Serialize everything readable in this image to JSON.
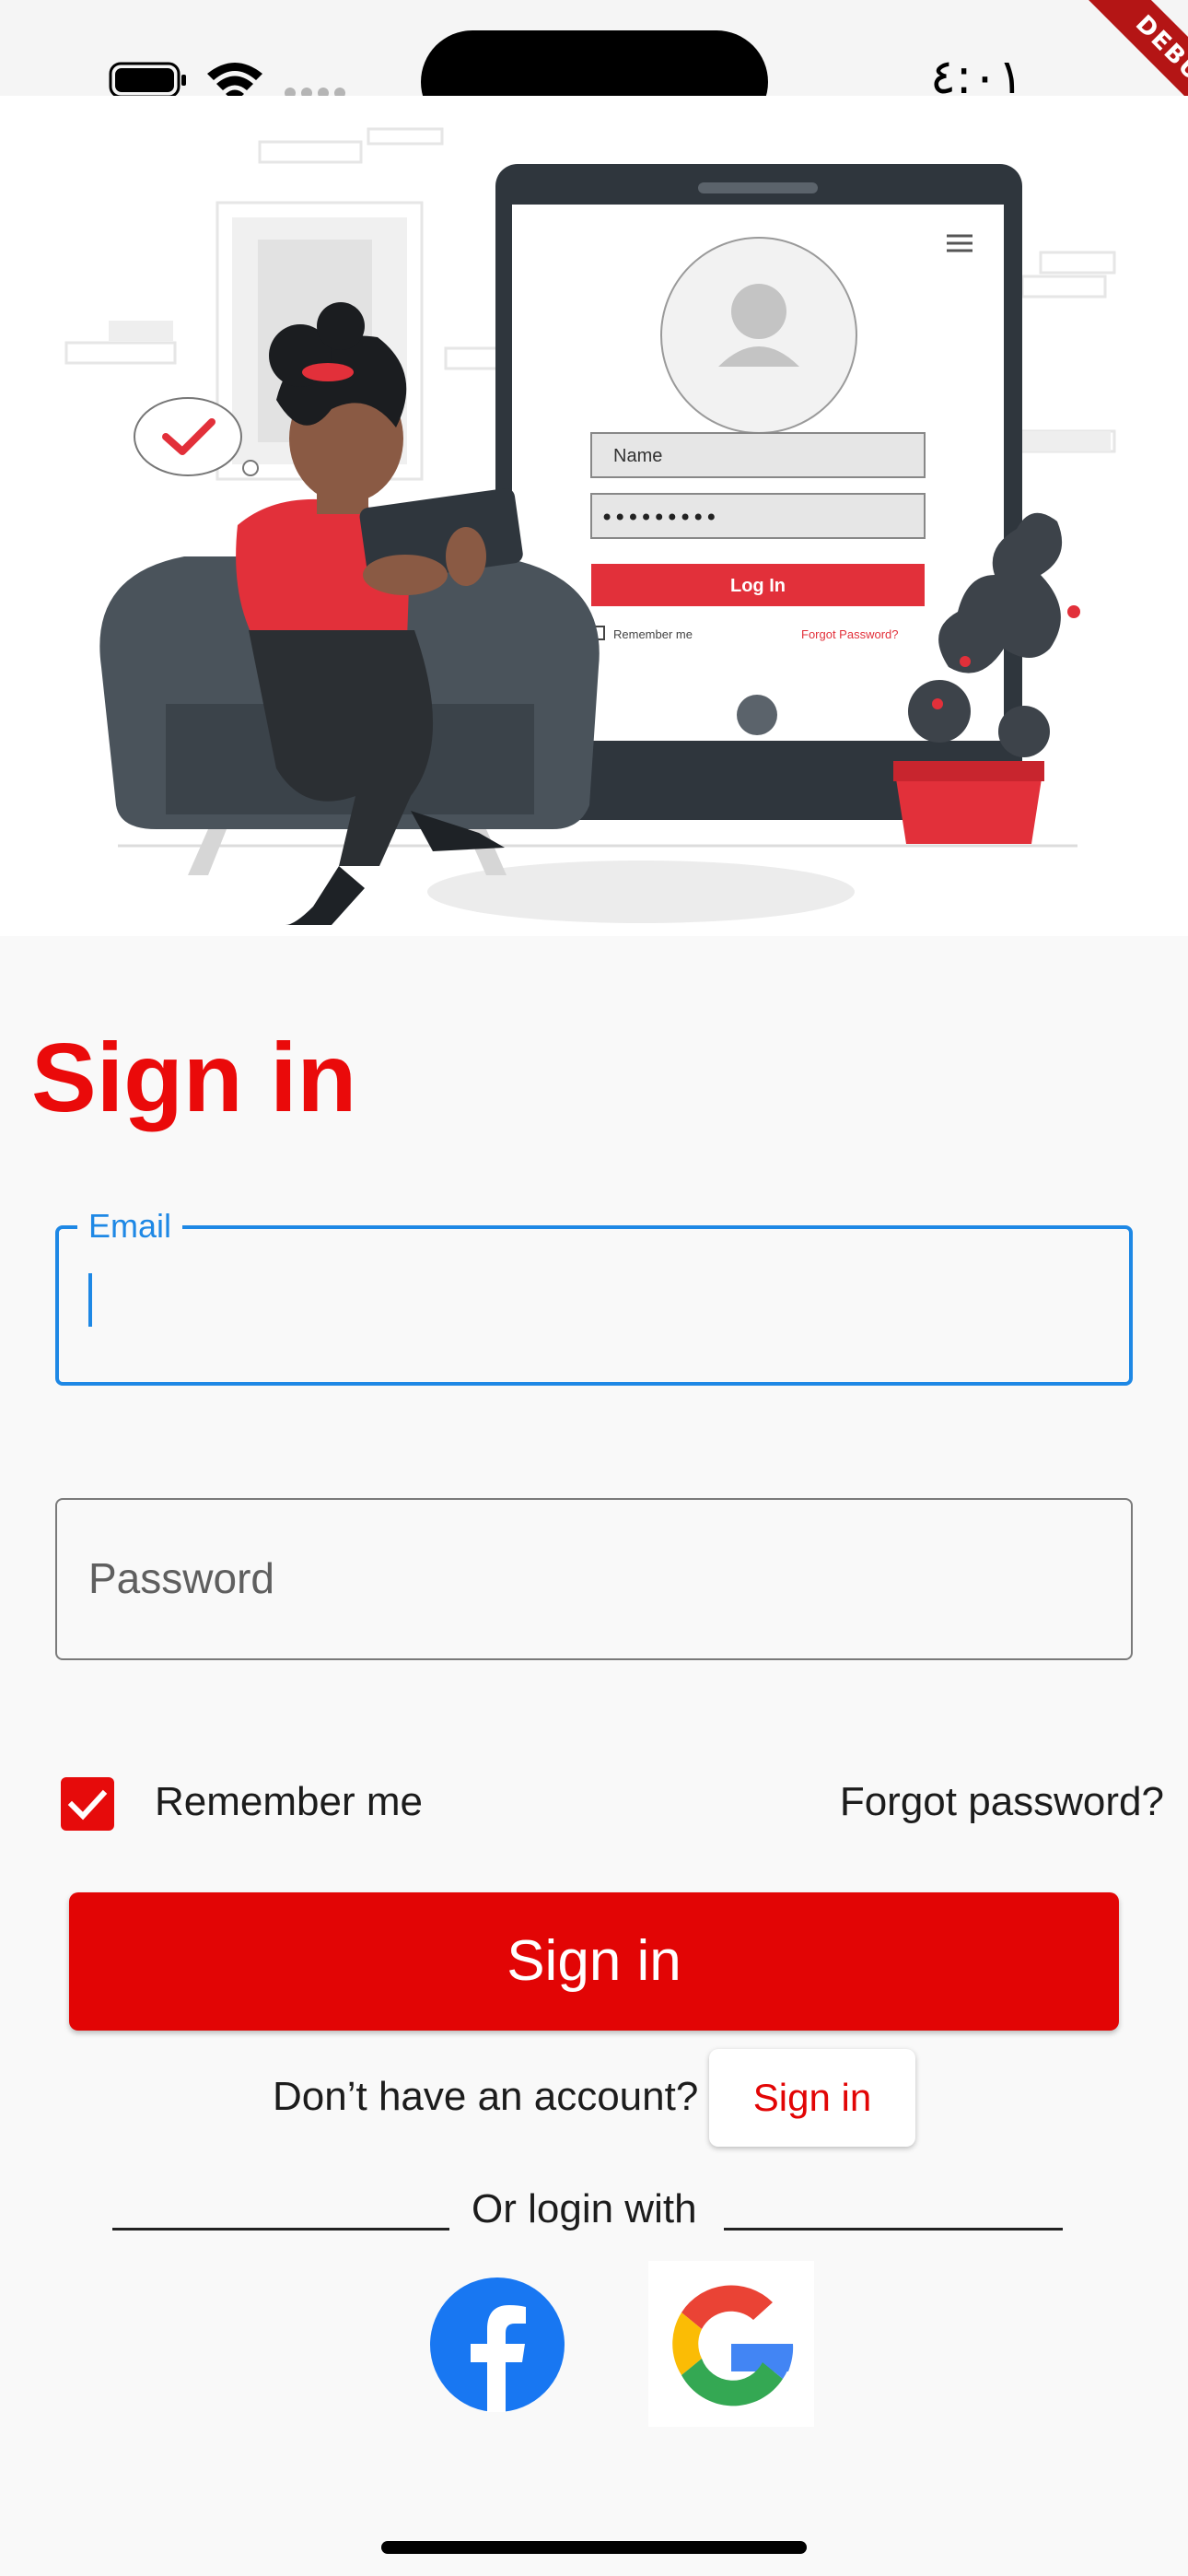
{
  "status_bar": {
    "time": "٤:٠١",
    "debug_banner": "DEBUG"
  },
  "hero": {
    "illustration": "person-with-tablet-login-illustration",
    "login_mock": {
      "name_placeholder": "Name",
      "password_dots": "•••••••••",
      "login_button": "Log In",
      "remember_me": "Remember me",
      "forgot_password": "Forgot Password?"
    }
  },
  "form": {
    "title": "Sign in",
    "email_label": "Email",
    "email_value": "",
    "password_placeholder": "Password",
    "remember_me_label": "Remember me",
    "remember_me_checked": true,
    "forgot_password": "Forgot password?",
    "submit_label": "Sign in"
  },
  "account": {
    "prompt": "Don’t have an account?",
    "link_label": "Sign in"
  },
  "social": {
    "divider_text": "Or login with",
    "providers": [
      "facebook-icon",
      "google-icon"
    ]
  },
  "colors": {
    "accent_red": "#e20505",
    "focus_blue": "#1e88e5",
    "facebook_blue": "#1877f2"
  }
}
